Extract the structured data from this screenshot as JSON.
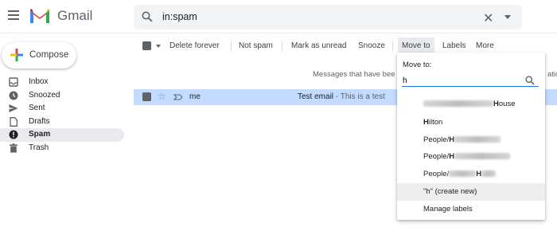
{
  "header": {
    "brand": "Gmail",
    "search_value": "in:spam"
  },
  "sidebar": {
    "compose_label": "Compose",
    "items": [
      {
        "label": "Inbox",
        "icon": "inbox-icon"
      },
      {
        "label": "Snoozed",
        "icon": "clock-icon"
      },
      {
        "label": "Sent",
        "icon": "send-icon"
      },
      {
        "label": "Drafts",
        "icon": "draft-icon"
      },
      {
        "label": "Spam",
        "icon": "spam-icon",
        "active": true
      },
      {
        "label": "Trash",
        "icon": "trash-icon"
      }
    ]
  },
  "toolbar": {
    "delete_forever": "Delete forever",
    "not_spam": "Not spam",
    "mark_unread": "Mark as unread",
    "snooze": "Snooze",
    "move_to": "Move to",
    "labels": "Labels",
    "more": "More"
  },
  "banner": {
    "text": "Messages that have bee",
    "tail": "atio"
  },
  "email_row": {
    "sender": "me",
    "subject": "Test email",
    "snippet": " - This is a test"
  },
  "move_menu": {
    "title": "Move to:",
    "input_value": "h",
    "items": [
      {
        "prefix": "",
        "bold": "H",
        "suffix": "ouse"
      },
      {
        "prefix": "",
        "bold": "H",
        "suffix": "ilton"
      },
      {
        "prefix": "People/",
        "bold": "H",
        "suffix": ""
      },
      {
        "prefix": "People/",
        "bold": "H",
        "suffix": ""
      },
      {
        "prefix": "People/",
        "bold": "H",
        "suffix": ""
      }
    ],
    "create_new": "\"h\" (create new)",
    "manage": "Manage labels"
  },
  "colors": {
    "selected_row": "#c2dbff",
    "accent": "#1a73e8",
    "gmail_red": "#ea4335"
  }
}
